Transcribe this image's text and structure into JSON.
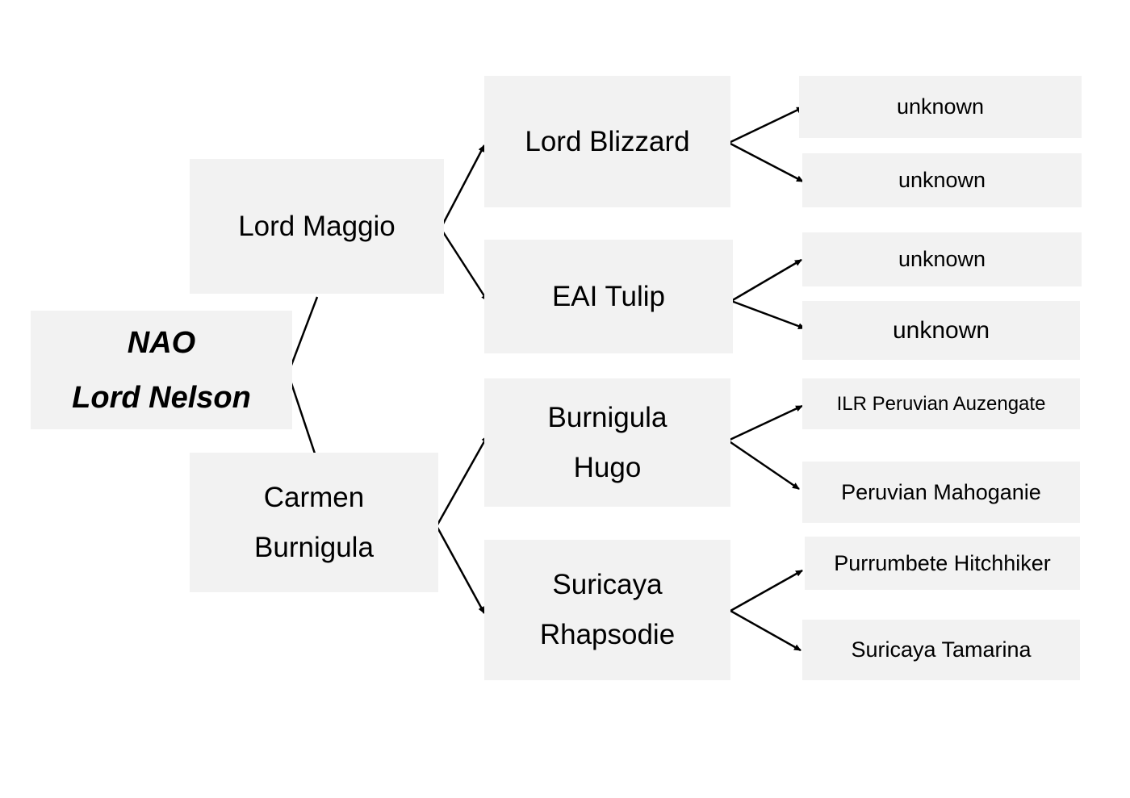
{
  "subject": {
    "lines": [
      "NAO",
      "Lord Nelson"
    ]
  },
  "parents": [
    {
      "lines": [
        "Lord Maggio"
      ]
    },
    {
      "lines": [
        "Carmen",
        "Burnigula"
      ]
    }
  ],
  "grandparents": [
    {
      "lines": [
        "Lord Blizzard"
      ]
    },
    {
      "lines": [
        "EAI Tulip"
      ]
    },
    {
      "lines": [
        "Burnigula",
        "Hugo"
      ]
    },
    {
      "lines": [
        "Suricaya",
        "Rhapsodie"
      ]
    }
  ],
  "great_grandparents": [
    {
      "label": "unknown"
    },
    {
      "label": "unknown"
    },
    {
      "label": "unknown"
    },
    {
      "label": "unknown"
    },
    {
      "label": "ILR Peruvian Auzengate"
    },
    {
      "label": "Peruvian Mahoganie"
    },
    {
      "label": "Purrumbete Hitchhiker"
    },
    {
      "label": "Suricaya Tamarina"
    }
  ],
  "colors": {
    "box": "#f2f2f2",
    "line": "#000000"
  }
}
